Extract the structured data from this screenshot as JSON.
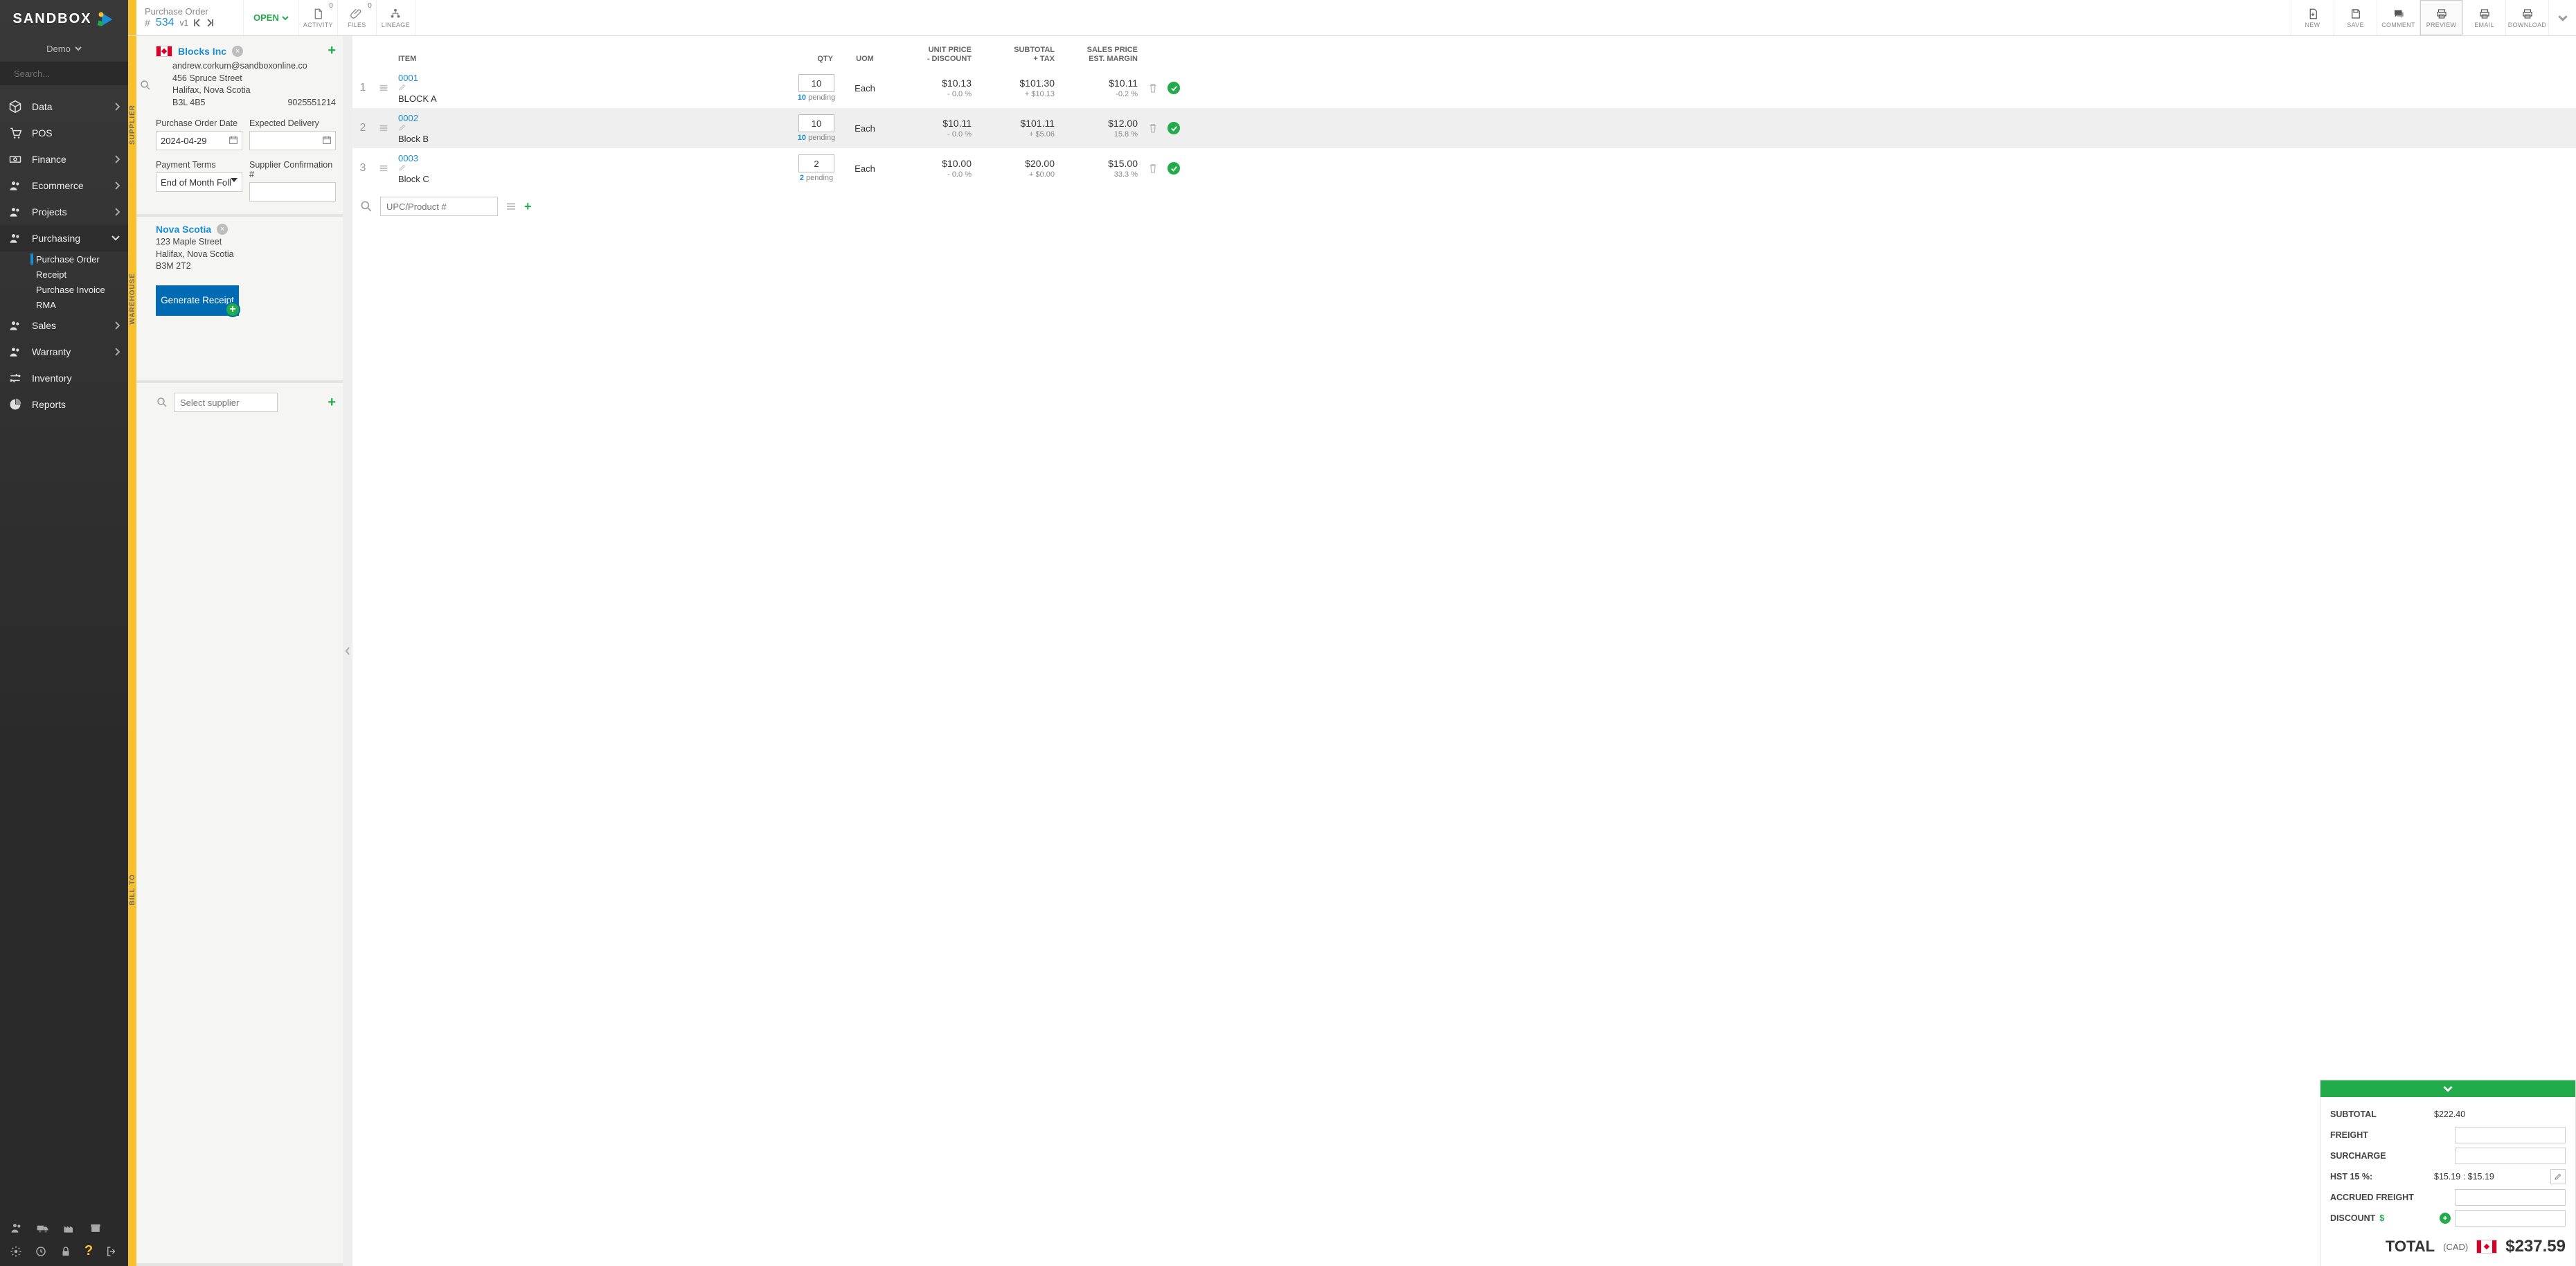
{
  "brand": "SANDBOX",
  "org": "Demo",
  "search_placeholder": "Search...",
  "nav": [
    {
      "label": "Data",
      "chev": true
    },
    {
      "label": "POS",
      "chev": false
    },
    {
      "label": "Finance",
      "chev": true
    },
    {
      "label": "Ecommerce",
      "chev": true
    },
    {
      "label": "Projects",
      "chev": true
    },
    {
      "label": "Purchasing",
      "chev": true,
      "expanded": true,
      "children": [
        {
          "label": "Purchase Order",
          "active": true
        },
        {
          "label": "Receipt"
        },
        {
          "label": "Purchase Invoice"
        },
        {
          "label": "RMA"
        }
      ]
    },
    {
      "label": "Sales",
      "chev": true
    },
    {
      "label": "Warranty",
      "chev": true
    },
    {
      "label": "Inventory",
      "chev": false
    },
    {
      "label": "Reports",
      "chev": false
    }
  ],
  "header": {
    "title": "Purchase Order",
    "hash": "# ",
    "num": "534",
    "ver": "v1",
    "status": "OPEN",
    "tools_left": [
      {
        "name": "activity",
        "label": "ACTIVITY",
        "badge": "0"
      },
      {
        "name": "files",
        "label": "FILES",
        "badge": "0"
      },
      {
        "name": "lineage",
        "label": "LINEAGE"
      }
    ],
    "tools_right": [
      {
        "name": "new",
        "label": "NEW"
      },
      {
        "name": "save",
        "label": "SAVE"
      },
      {
        "name": "comment",
        "label": "COMMENT"
      },
      {
        "name": "preview",
        "label": "PREVIEW",
        "active": true
      },
      {
        "name": "email",
        "label": "EMAIL"
      },
      {
        "name": "download",
        "label": "DOWNLOAD"
      }
    ]
  },
  "supplier": {
    "sect": "SUPPLIER",
    "name": "Blocks Inc",
    "email": "andrew.corkum@sandboxonline.co",
    "street": "456 Spruce Street",
    "city": "Halifax, Nova Scotia",
    "postal": "B3L 4B5",
    "phone": "9025551214",
    "po_date_label": "Purchase Order Date",
    "po_date": "2024-04-29",
    "exp_label": "Expected Delivery",
    "terms_label": "Payment Terms",
    "terms": "End of Month Foll",
    "conf_label": "Supplier Confirmation #"
  },
  "warehouse": {
    "sect": "WAREHOUSE",
    "name": "Nova Scotia",
    "street": "123 Maple Street",
    "city": "Halifax, Nova Scotia",
    "postal": "B3M 2T2",
    "button": "Generate Receipt"
  },
  "billto": {
    "sect": "BILL TO",
    "placeholder": "Select supplier"
  },
  "grid": {
    "headers": {
      "item": "ITEM",
      "qty": "QTY",
      "uom": "UOM",
      "unit1": "UNIT PRICE",
      "unit2": "- DISCOUNT",
      "sub1": "SUBTOTAL",
      "sub2": "+ TAX",
      "sale1": "SALES PRICE",
      "sale2": "EST. MARGIN"
    },
    "rows": [
      {
        "idx": "1",
        "sku": "0001",
        "desc": "BLOCK A",
        "qty": "10",
        "pending": "10",
        "pending_sfx": " pending",
        "uom": "Each",
        "unit": "$10.13",
        "unit_sub": "- 0.0 %",
        "sub": "$101.30",
        "sub_sub": "+ $10.13",
        "sale": "$10.11",
        "sale_sub": "-0.2 %"
      },
      {
        "idx": "2",
        "sku": "0002",
        "desc": "Block B",
        "qty": "10",
        "pending": "10",
        "pending_sfx": " pending",
        "uom": "Each",
        "unit": "$10.11",
        "unit_sub": "- 0.0 %",
        "sub": "$101.11",
        "sub_sub": "+ $5.06",
        "sale": "$12.00",
        "sale_sub": "15.8 %"
      },
      {
        "idx": "3",
        "sku": "0003",
        "desc": "Block C",
        "qty": "2",
        "pending": "2",
        "pending_sfx": " pending",
        "uom": "Each",
        "unit": "$10.00",
        "unit_sub": "- 0.0 %",
        "sub": "$20.00",
        "sub_sub": "+ $0.00",
        "sale": "$15.00",
        "sale_sub": "33.3 %"
      }
    ],
    "add_placeholder": "UPC/Product #"
  },
  "totals": {
    "subtotal_l": "SUBTOTAL",
    "subtotal_v": "$222.40",
    "freight_l": "FREIGHT",
    "surcharge_l": "SURCHARGE",
    "hst_l": "HST 15 %:",
    "hst_v": "$15.19 : $15.19",
    "accrued_l": "ACCRUED FREIGHT",
    "discount_l": "DISCOUNT",
    "total_l": "TOTAL",
    "ccy": "(CAD)",
    "total_v": "$237.59"
  }
}
